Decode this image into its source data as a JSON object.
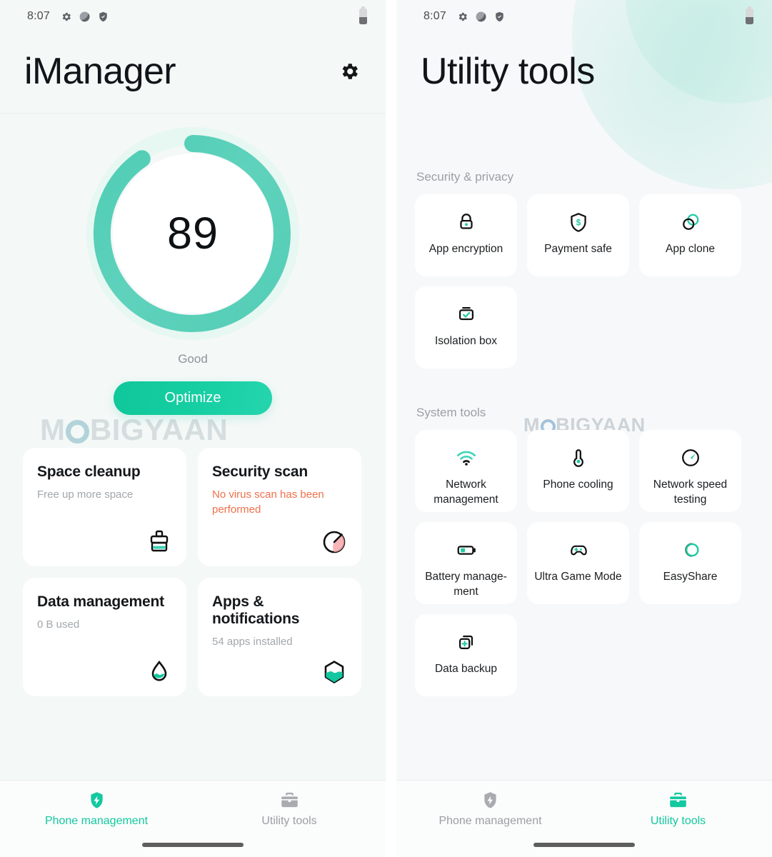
{
  "meta": {
    "accent": "#12c9a0",
    "ring": "#5ccfb8",
    "ring_track": "#e2f5f0",
    "warn": "#f0704a",
    "watermark": "MOBIGYAAN"
  },
  "statusbar": {
    "time": "8:07",
    "icons": [
      "gear-icon",
      "half-moon-icon",
      "shield-icon"
    ],
    "battery": "battery-icon"
  },
  "left": {
    "header": {
      "title": "iManager",
      "settings_icon": "gear-icon"
    },
    "gauge": {
      "score": "89",
      "status": "Good",
      "value": 89,
      "max": 100
    },
    "optimize_label": "Optimize",
    "cards": [
      {
        "title": "Space cleanup",
        "sub": "Free up more space",
        "warn": false,
        "icon": "cleanup-brush-icon"
      },
      {
        "title": "Security scan",
        "sub": "No virus scan has been performed",
        "warn": true,
        "icon": "speed-dial-icon"
      },
      {
        "title": "Data management",
        "sub": "0 B used",
        "warn": false,
        "icon": "water-drop-icon"
      },
      {
        "title": "Apps & notifications",
        "sub": "54 apps installed",
        "warn": false,
        "icon": "hexagon-icon"
      }
    ],
    "nav": [
      {
        "label": "Phone management",
        "icon": "shield-bolt-icon",
        "active": true
      },
      {
        "label": "Utility tools",
        "icon": "toolbox-icon",
        "active": false
      }
    ]
  },
  "right": {
    "header": {
      "title": "Utility tools"
    },
    "sections": [
      {
        "label": "Security & privacy",
        "tiles": [
          {
            "label": "App encryption",
            "icon": "lock-icon"
          },
          {
            "label": "Payment safe",
            "icon": "shield-dollar-icon"
          },
          {
            "label": "App clone",
            "icon": "two-circles-icon"
          },
          {
            "label": "Isolation box",
            "icon": "box-check-icon"
          }
        ]
      },
      {
        "label": "System tools",
        "tiles": [
          {
            "label": "Network management",
            "icon": "wifi-icon"
          },
          {
            "label": "Phone cooling",
            "icon": "thermometer-icon"
          },
          {
            "label": "Network speed testing",
            "icon": "speedometer-icon"
          },
          {
            "label": "Battery manage-ment",
            "icon": "battery-icon"
          },
          {
            "label": "Ultra Game Mode",
            "icon": "gamepad-icon"
          },
          {
            "label": "EasyShare",
            "icon": "link-circles-icon"
          },
          {
            "label": "Data backup",
            "icon": "copy-plus-icon"
          }
        ]
      }
    ],
    "nav": [
      {
        "label": "Phone management",
        "icon": "shield-bolt-icon",
        "active": false
      },
      {
        "label": "Utility tools",
        "icon": "toolbox-icon",
        "active": true
      }
    ]
  }
}
